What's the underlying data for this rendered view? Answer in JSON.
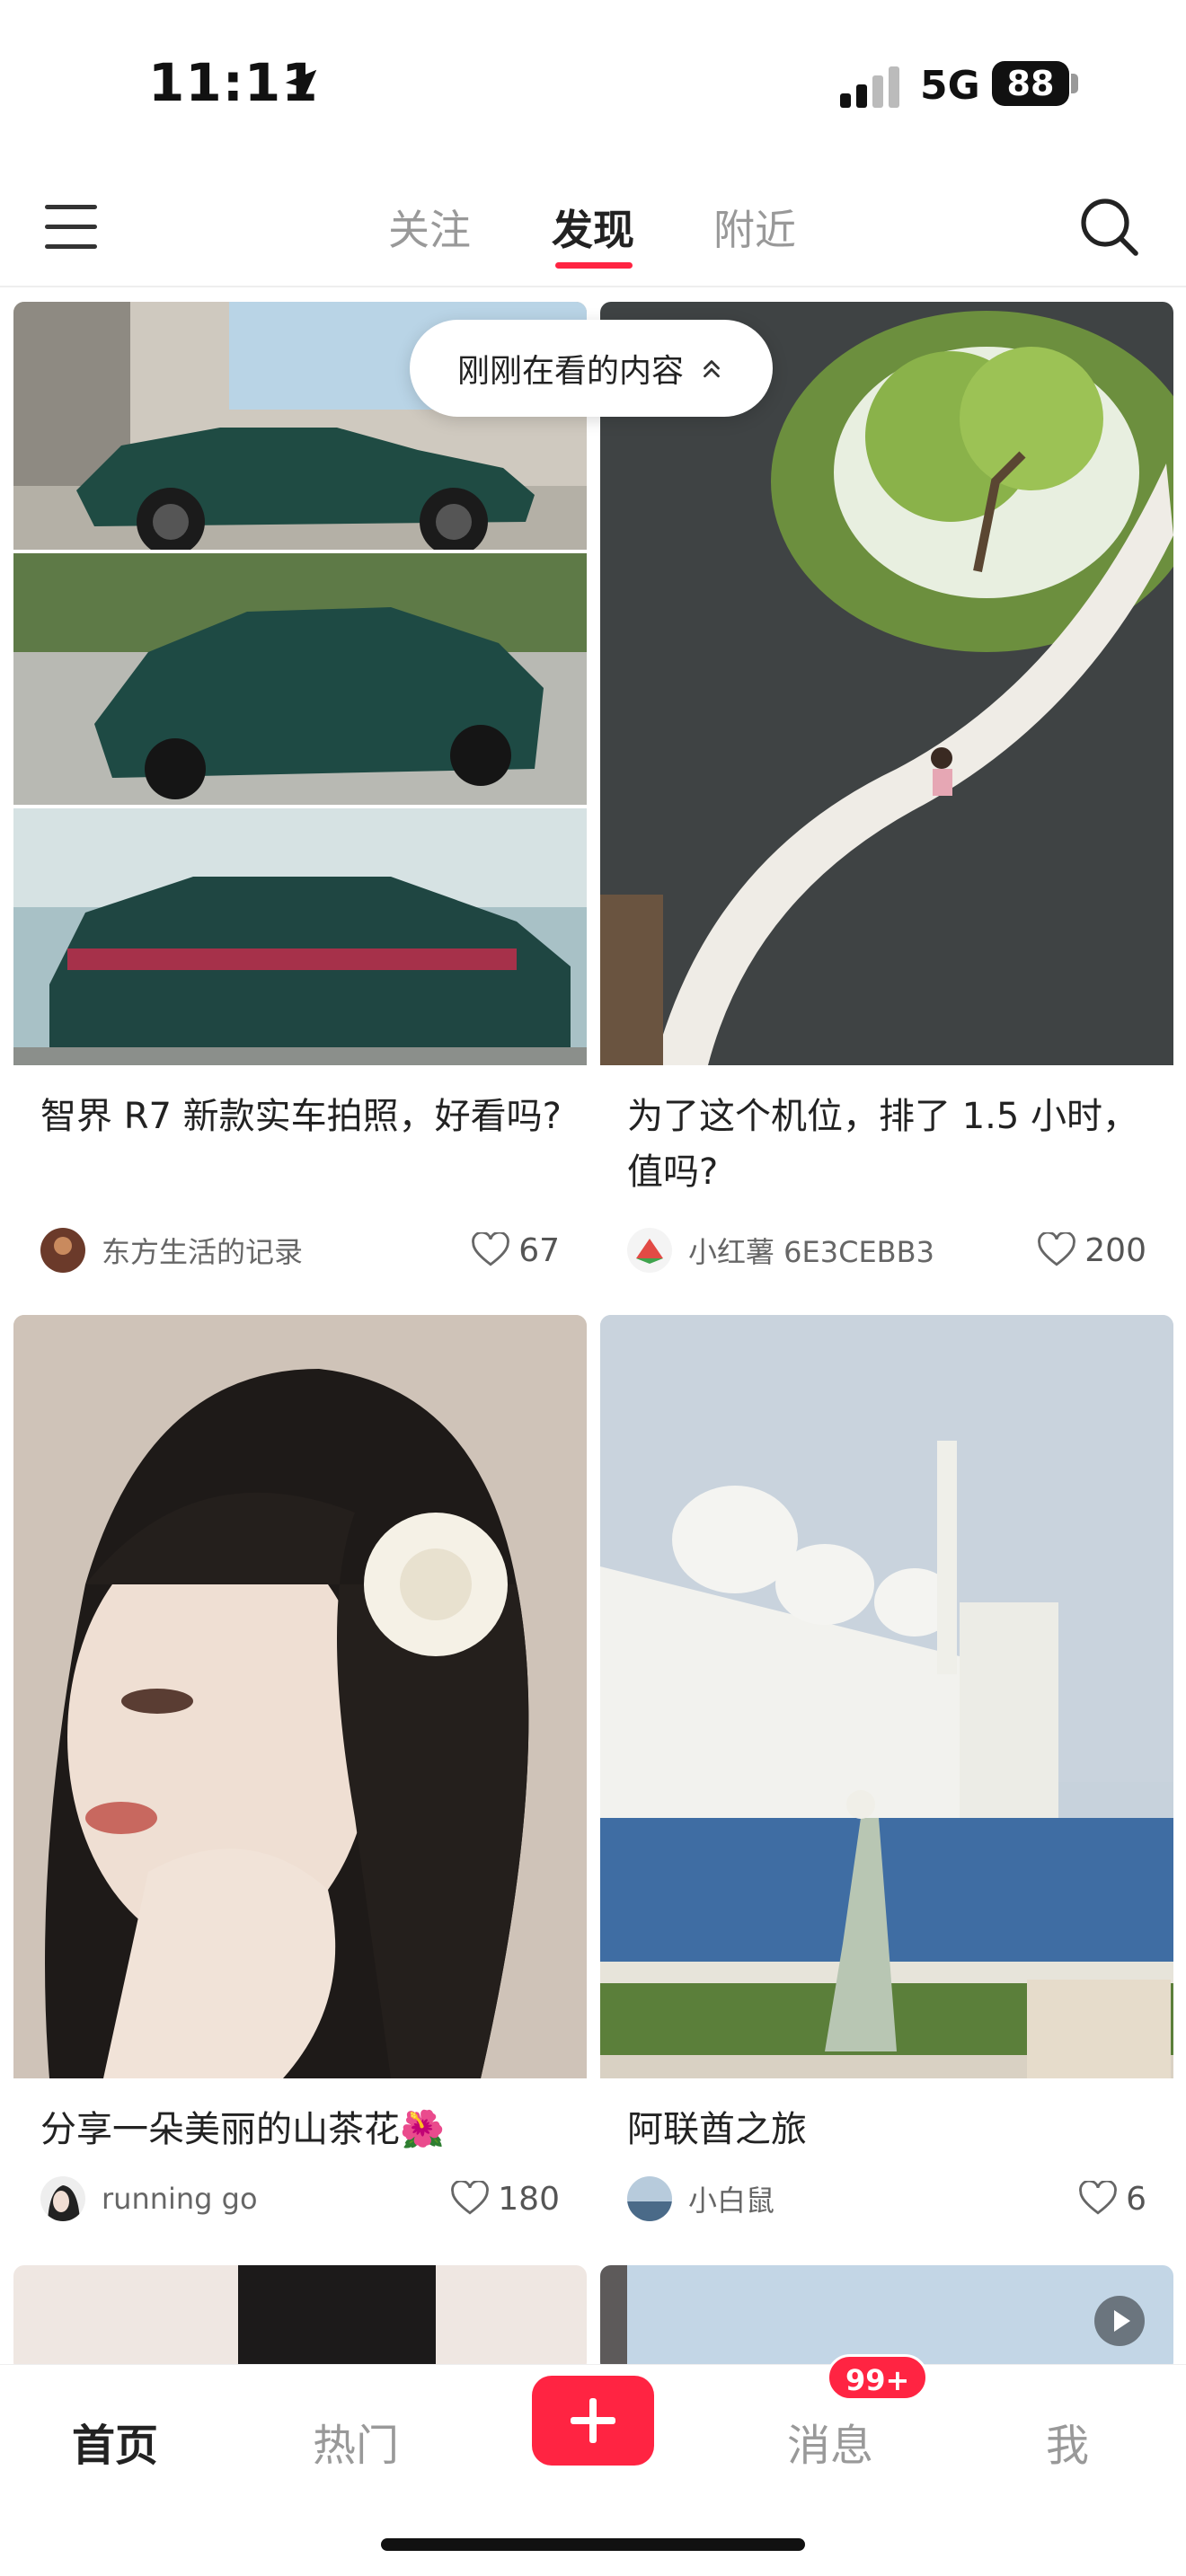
{
  "status_bar": {
    "time": "11:11",
    "network": "5G",
    "battery": "88"
  },
  "header": {
    "tabs": [
      {
        "label": "关注",
        "active": false
      },
      {
        "label": "发现",
        "active": true
      },
      {
        "label": "附近",
        "active": false
      }
    ]
  },
  "recent_pill": {
    "label": "刚刚在看的内容"
  },
  "feed": [
    {
      "title": "智界 R7 新款实车拍照，好看吗?",
      "author": "东方生活的记录",
      "likes": "67"
    },
    {
      "title": "为了这个机位，排了 1.5 小时，值吗?",
      "author": "小红薯 6E3CEBB3",
      "likes": "200"
    },
    {
      "title": "分享一朵美丽的山茶花🌺",
      "author": "running go",
      "likes": "180"
    },
    {
      "title": "阿联酋之旅",
      "author": "小白鼠",
      "likes": "6"
    }
  ],
  "bottom_nav": {
    "home": "首页",
    "hot": "热门",
    "messages": "消息",
    "messages_badge": "99+",
    "me": "我"
  },
  "colors": {
    "accent": "#ff2442"
  },
  "icons": [
    "location-arrow-icon",
    "menu-icon",
    "search-icon",
    "chevron-up-icon",
    "heart-icon",
    "play-icon",
    "plus-icon"
  ]
}
